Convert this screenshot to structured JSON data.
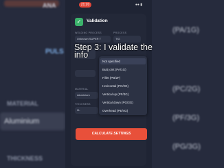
{
  "status_bar": {
    "time": "21:20"
  },
  "header": {
    "title": "Validation"
  },
  "form": {
    "welding_process_label": "WELDING PROCESS",
    "welding_process_value": "Unknown SUPER T",
    "process_label": "PROCESS",
    "process_value": "TIG",
    "material_label": "MATERIAL",
    "material_value": "Aluminium",
    "thickness_label": "THICKNESS",
    "thickness_value": "2L"
  },
  "overlay": {
    "caption": "Step 3: I validate the info"
  },
  "position_dropdown": {
    "options": [
      "Not specified",
      "Butt joint (PA/1G)",
      "Fillet (PB/2F)",
      "Horizontal (PC/2G)",
      "Vertical up (PF/3G)",
      "Vertical down (PG/3G)",
      "Overhead (PE/4G)"
    ],
    "selected_index": 0
  },
  "actions": {
    "calculate_label": "CALCULATE SETTINGS"
  },
  "background": {
    "left_top": "ANA",
    "left_mid": "MATERIAL",
    "left_field": "Aluminium",
    "left_bottom": "THICKNESS",
    "right_items": [
      "(PA/1G)",
      "(PC/2G)",
      "(PF/3G)",
      "(PG/3G)"
    ],
    "pulse_label": "PULS"
  }
}
